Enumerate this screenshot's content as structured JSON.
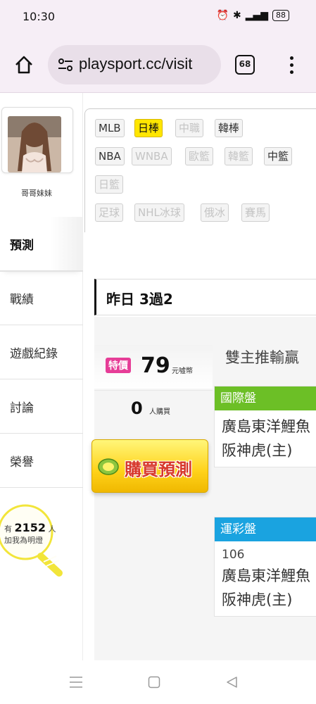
{
  "status": {
    "time": "10:30",
    "icons": "⏰ ✱ ᵛᵒ ⁴ᴳ",
    "battery": "88"
  },
  "browser": {
    "url": "playsport.cc/visit",
    "tab_count": "68"
  },
  "sidebar": {
    "username": "哥哥妹妹",
    "items": [
      {
        "label": "預測"
      },
      {
        "label": "戰績"
      },
      {
        "label": "遊戲紀錄"
      },
      {
        "label": "討論"
      },
      {
        "label": "榮譽"
      }
    ],
    "fans": {
      "prefix": "有",
      "count": "2152",
      "suffix": "人",
      "line2": "加我為明燈"
    }
  },
  "sports": {
    "row1": [
      "MLB",
      "日棒",
      "中職",
      "韓棒"
    ],
    "row2": [
      "NBA",
      "WNBA",
      "歐籃",
      "韓籃",
      "中籃"
    ],
    "row3": [
      "日籃"
    ],
    "row4": [
      "足球",
      "NHL冰球",
      "俄冰",
      "賽馬"
    ]
  },
  "record": {
    "text": "昨日 3過2"
  },
  "prediction": {
    "promo_tag": "特價",
    "price": "79",
    "price_unit": "元噓幣",
    "buyers": "0",
    "buyers_unit": "人購買",
    "buy_label": "購買預測",
    "topic": "雙主推輸贏",
    "panels": [
      {
        "title": "國際盤",
        "color": "#6cbf26",
        "code": "",
        "teams": [
          "廣島東洋鯉魚",
          "阪神虎(主)"
        ]
      },
      {
        "title": "運彩盤",
        "color": "#1aa3e0",
        "code": "106",
        "teams": [
          "廣島東洋鯉魚",
          "阪神虎(主)"
        ]
      }
    ]
  }
}
